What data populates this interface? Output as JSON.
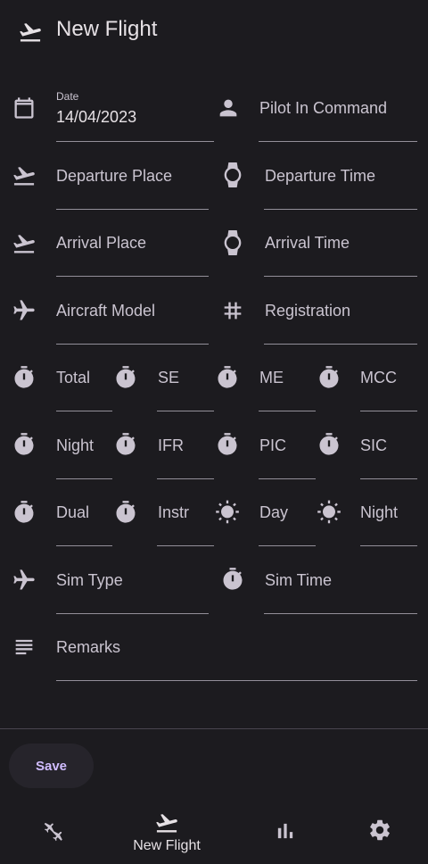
{
  "app": {
    "title": "New Flight"
  },
  "form": {
    "date": {
      "label": "Date",
      "value": "14/04/2023"
    },
    "pilot_in_command": {
      "label": "Pilot In Command"
    },
    "departure_place": {
      "label": "Departure Place"
    },
    "departure_time": {
      "label": "Departure Time"
    },
    "arrival_place": {
      "label": "Arrival Place"
    },
    "arrival_time": {
      "label": "Arrival Time"
    },
    "aircraft_model": {
      "label": "Aircraft Model"
    },
    "registration": {
      "label": "Registration"
    },
    "total": {
      "label": "Total"
    },
    "se": {
      "label": "SE"
    },
    "me": {
      "label": "ME"
    },
    "mcc": {
      "label": "MCC"
    },
    "night_time": {
      "label": "Night"
    },
    "ifr": {
      "label": "IFR"
    },
    "pic": {
      "label": "PIC"
    },
    "sic": {
      "label": "SIC"
    },
    "dual": {
      "label": "Dual"
    },
    "instr": {
      "label": "Instr"
    },
    "day_landings": {
      "label": "Day"
    },
    "night_landings": {
      "label": "Night"
    },
    "sim_type": {
      "label": "Sim Type"
    },
    "sim_time": {
      "label": "Sim Time"
    },
    "remarks": {
      "label": "Remarks"
    }
  },
  "actions": {
    "save_label": "Save"
  },
  "bottom_nav": {
    "items": [
      {
        "icon": "flight-log-icon",
        "label": ""
      },
      {
        "icon": "flight-takeoff-icon",
        "label": "New Flight",
        "selected": true
      },
      {
        "icon": "bar-chart-icon",
        "label": ""
      },
      {
        "icon": "gear-icon",
        "label": ""
      }
    ]
  },
  "colors": {
    "background": "#1c1b1f",
    "text": "#e6e1e5",
    "label": "#cac4d0",
    "underline": "#938f99",
    "accent": "#d0bcff"
  }
}
